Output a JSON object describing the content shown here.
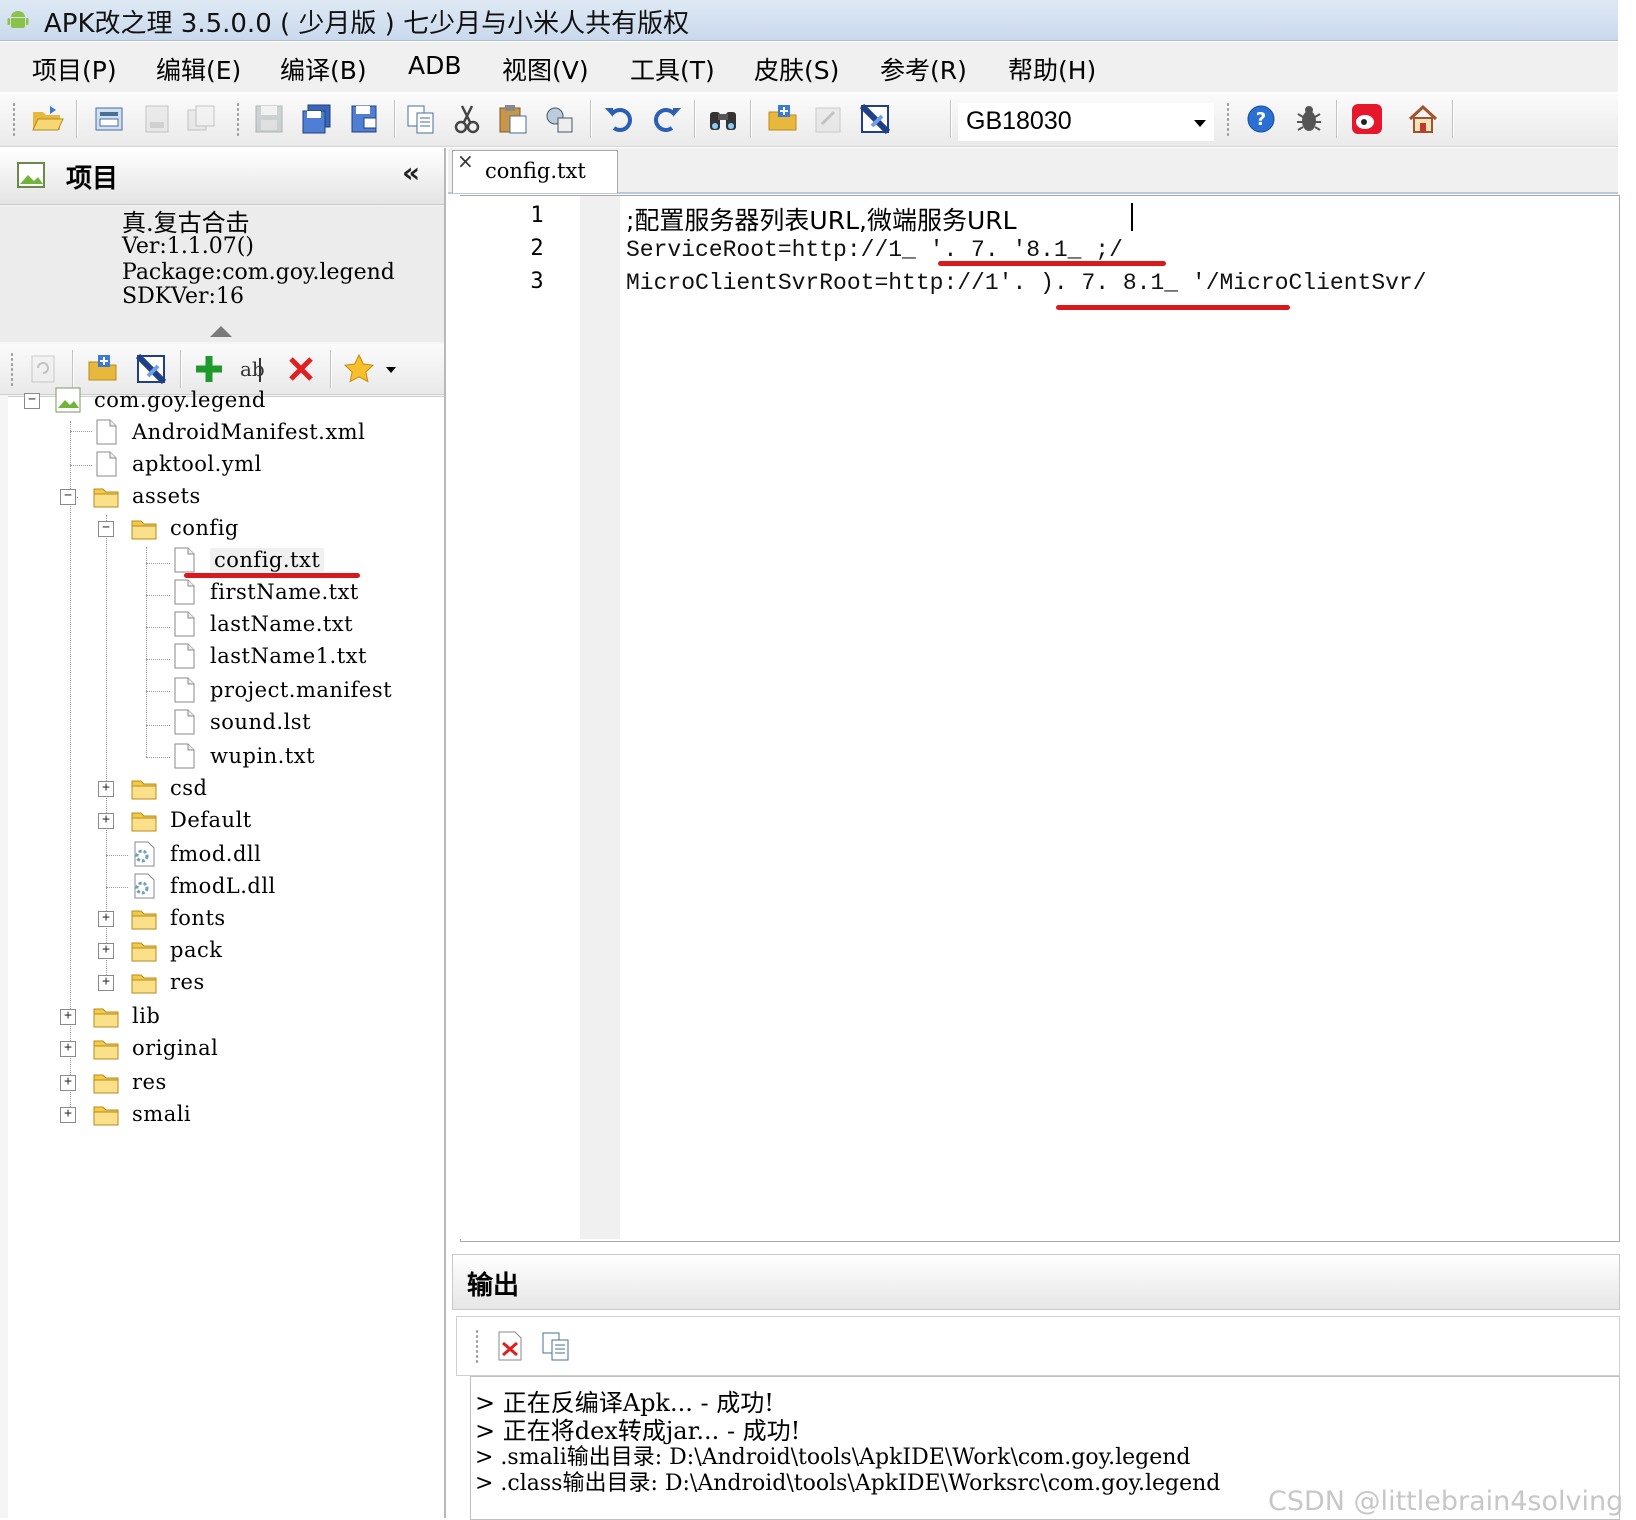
{
  "window": {
    "title": "APK改之理 3.5.0.0 ( 少月版 ) 七少月与小米人共有版权"
  },
  "menu": [
    "项目(P)",
    "编辑(E)",
    "编译(B)",
    "ADB",
    "视图(V)",
    "工具(T)",
    "皮肤(S)",
    "参考(R)",
    "帮助(H)"
  ],
  "toolbar": {
    "encoding": "GB18030"
  },
  "project_panel": {
    "title": "项目",
    "collapse": "«",
    "info": {
      "name": "真.复古合击",
      "version": "Ver:1.1.07()",
      "package": "Package:com.goy.legend",
      "sdk": "SDKVer:16"
    }
  },
  "tree": {
    "root": "com.goy.legend",
    "android_manifest": "AndroidManifest.xml",
    "apktool": "apktool.yml",
    "assets": "assets",
    "config": "config",
    "config_txt": "config.txt",
    "first_name": "firstName.txt",
    "last_name": "lastName.txt",
    "last_name1": "lastName1.txt",
    "project_manifest": "project.manifest",
    "sound_lst": "sound.lst",
    "wupin": "wupin.txt",
    "csd": "csd",
    "default": "Default",
    "fmod": "fmod.dll",
    "fmodl": "fmodL.dll",
    "fonts": "fonts",
    "pack": "pack",
    "res_assets": "res",
    "lib": "lib",
    "original": "original",
    "res": "res",
    "smali": "smali"
  },
  "editor": {
    "tab": "config.txt",
    "tab_close": "×",
    "lines": [
      {
        "no": "1",
        "text": ";配置服务器列表URL,微端服务URL"
      },
      {
        "no": "2",
        "text": "ServiceRoot=http://1_ '. 7. '8.1_ ;/"
      },
      {
        "no": "3",
        "text": "MicroClientSvrRoot=http://1'. ). 7. 8.1_ '/MicroClientSvr/"
      }
    ]
  },
  "output": {
    "title": "输出",
    "lines": [
      "> 正在反编译Apk...  - 成功!",
      "> 正在将dex转成jar...  - 成功!",
      "> .smali输出目录: D:\\Android\\tools\\ApkIDE\\Work\\com.goy.legend",
      "> .class输出目录: D:\\Android\\tools\\ApkIDE\\Worksrc\\com.goy.legend"
    ]
  },
  "watermark": "CSDN @littlebrain4solving",
  "colors": {
    "annotation_red": "#d9191c",
    "folder_yellow": "#f3c948"
  }
}
